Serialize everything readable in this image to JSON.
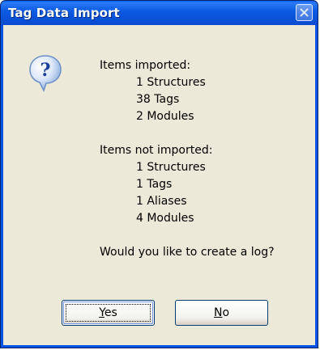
{
  "dialog": {
    "title": "Tag Data Import",
    "close_icon": "close-icon",
    "icon": "question-icon"
  },
  "message": {
    "imported_header": "Items imported:",
    "imported": [
      "1 Structures",
      "38 Tags",
      "2 Modules"
    ],
    "not_imported_header": "Items not imported:",
    "not_imported": [
      "1 Structures",
      "1 Tags",
      "1 Aliases",
      "4 Modules"
    ],
    "question": "Would you like to create a log?"
  },
  "buttons": {
    "yes_mnemonic": "Y",
    "yes_rest": "es",
    "no_mnemonic": "N",
    "no_rest": "o"
  },
  "colors": {
    "titlebar": "#0a53d9",
    "client": "#ece9d8",
    "button_border": "#003c74"
  }
}
